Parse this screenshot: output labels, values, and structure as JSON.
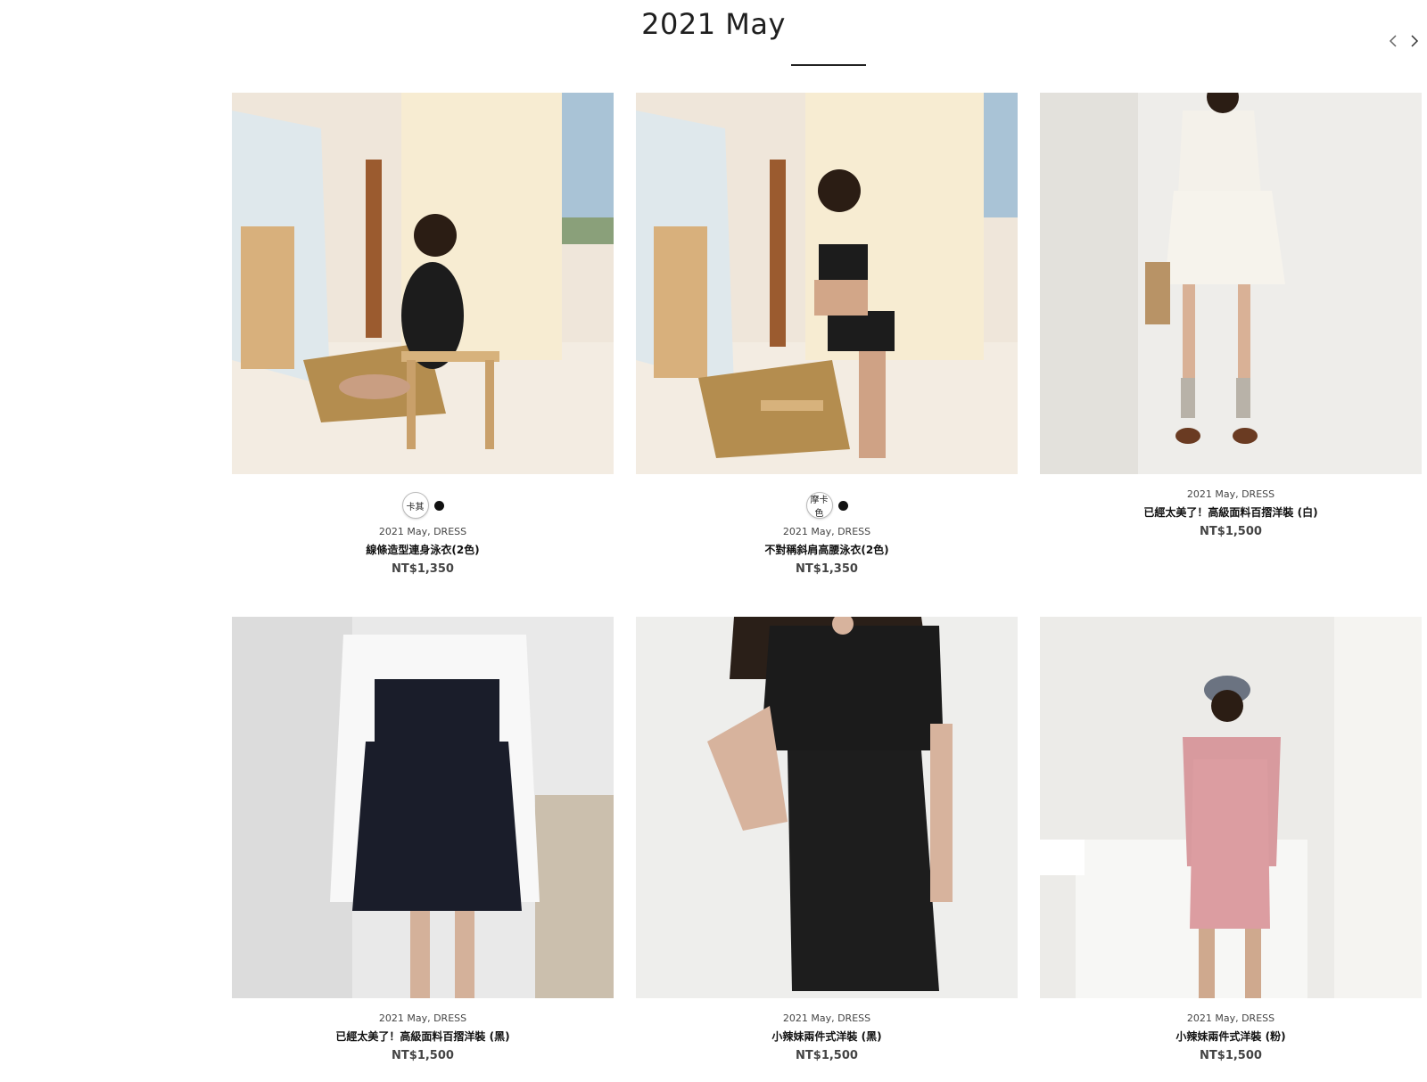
{
  "section": {
    "title": "2021 May"
  },
  "nav": {
    "prev_icon": "chevron-left-icon",
    "next_icon": "chevron-right-icon"
  },
  "products": [
    {
      "swatch_label": "卡其",
      "swatch_color": "#111111",
      "category": "2021 May, DRESS",
      "name": "線條造型連身泳衣(2色)",
      "price": "NT$1,350"
    },
    {
      "swatch_label": "摩卡色",
      "swatch_color": "#111111",
      "category": "2021 May, DRESS",
      "name": "不對稱斜肩高腰泳衣(2色)",
      "price": "NT$1,350"
    },
    {
      "category": "2021 May, DRESS",
      "name": "已經太美了！高級面料百摺洋裝 (白)",
      "price": "NT$1,500"
    },
    {
      "category": "2021 May, DRESS",
      "name": "已經太美了！高級面料百摺洋裝 (黑)",
      "price": "NT$1,500"
    },
    {
      "category": "2021 May, DRESS",
      "name": "小辣妹兩件式洋裝 (黑)",
      "price": "NT$1,500"
    },
    {
      "category": "2021 May, DRESS",
      "name": "小辣妹兩件式洋裝 (粉)",
      "price": "NT$1,500"
    }
  ]
}
